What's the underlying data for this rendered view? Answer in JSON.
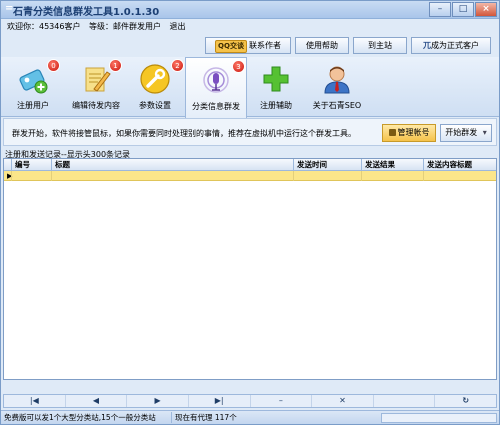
{
  "window": {
    "title": "石青分类信息群发工具1.0.1.30",
    "buttons": {
      "min": "–",
      "max": "□",
      "close": "×"
    }
  },
  "info": {
    "welcome": "欢迎你：45346客户",
    "level": "等级：邮件群发用户",
    "logout": "退出"
  },
  "top_buttons": {
    "qq_badge": "QQ交谈",
    "contact": "联系作者",
    "help": "使用帮助",
    "home": "到主站",
    "upgrade": "成为正式客户",
    "upgrade_icon": "兀"
  },
  "toolbar": [
    {
      "label": "注册用户",
      "badge": "0",
      "icon": "register-icon"
    },
    {
      "label": "编辑待发内容",
      "badge": "1",
      "icon": "edit-icon"
    },
    {
      "label": "参数设置",
      "badge": "2",
      "icon": "settings-icon"
    },
    {
      "label": "分类信息群发",
      "badge": "3",
      "icon": "broadcast-icon",
      "active": true
    },
    {
      "label": "注册辅助",
      "icon": "plus-icon"
    },
    {
      "label": "关于石青SEO",
      "icon": "user-icon"
    }
  ],
  "panel": {
    "message": "群发开始，软件将接管鼠标，如果你需要同时处理别的事情，推荐在虚拟机中运行这个群发工具。",
    "manage_account": "管理帐号",
    "start": "开始群发",
    "start_arrow": "▾"
  },
  "record_caption": "注册和发送记录--显示头300条记录",
  "grid": {
    "columns": [
      "编号",
      "标题",
      "发送时间",
      "发送结果",
      "发送内容标题"
    ],
    "row_marker": "▶"
  },
  "navigator": [
    "|◀",
    "◀",
    "▶",
    "▶|",
    "–",
    "✕",
    "",
    "↻"
  ],
  "status": {
    "left": "免费版可以发1个大型分类站,15个一般分类站",
    "right": "现在有代理 117个"
  }
}
